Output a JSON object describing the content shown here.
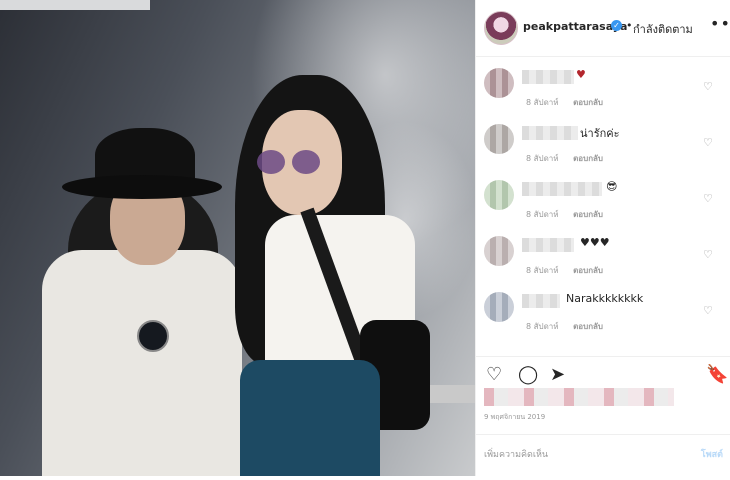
{
  "post": {
    "username": "peakpattarasaya",
    "verified_mark": "✓",
    "separator": "•",
    "follow_label": "กำลังติดตาม",
    "more_label": "•••"
  },
  "comments": [
    {
      "text": "♥",
      "time": "8 สัปดาห์",
      "reply": "ตอบกลับ",
      "avatar_color": "#b59a9e"
    },
    {
      "text": "น่ารักค่ะ",
      "time": "8 สัปดาห์",
      "reply": "ตอบกลับ",
      "avatar_color": "#b6b0ad"
    },
    {
      "text": "😎",
      "time": "8 สัปดาห์",
      "reply": "ตอบกลับ",
      "avatar_color": "#bcd1b6"
    },
    {
      "text": "♥♥♥",
      "time": "8 สัปดาห์",
      "reply": "ตอบกลับ",
      "avatar_color": "#c4b8b8"
    },
    {
      "text": "Narakkkkkkkk",
      "time": "8 สัปดาห์",
      "reply": "ตอบกลับ",
      "avatar_color": "#aeb6c4"
    }
  ],
  "like_icon": "♡",
  "actions": {
    "like": "♡",
    "comment": "◯",
    "share": "➤",
    "save": "🔖"
  },
  "date": "9 พฤศจิกายน 2019",
  "add_comment": {
    "placeholder": "เพิ่มความคิดเห็น",
    "post": "โพสต์"
  }
}
